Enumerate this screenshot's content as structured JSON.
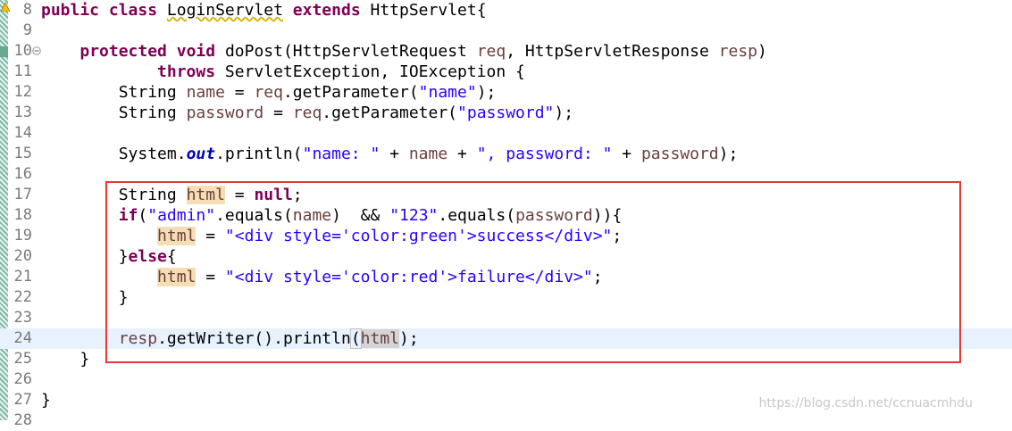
{
  "editor": {
    "lines": [
      {
        "n": "8"
      },
      {
        "n": "9"
      },
      {
        "n": "10"
      },
      {
        "n": "11"
      },
      {
        "n": "12"
      },
      {
        "n": "13"
      },
      {
        "n": "14"
      },
      {
        "n": "15"
      },
      {
        "n": "16"
      },
      {
        "n": "17"
      },
      {
        "n": "18"
      },
      {
        "n": "19"
      },
      {
        "n": "20"
      },
      {
        "n": "21"
      },
      {
        "n": "22"
      },
      {
        "n": "23"
      },
      {
        "n": "24"
      },
      {
        "n": "25"
      },
      {
        "n": "26"
      },
      {
        "n": "27"
      },
      {
        "n": "28"
      }
    ],
    "code": {
      "l8": {
        "kw1": "public",
        "kw2": "class",
        "cls": "LoginServlet",
        "kw3": "extends",
        "rest": "HttpServlet{"
      },
      "l10": {
        "kw1": "protected",
        "kw2": "void",
        "rest1": "doPost(HttpServletRequest ",
        "p1": "req",
        "rest2": ", HttpServletResponse ",
        "p2": "resp",
        "rest3": ")"
      },
      "l11": {
        "kw": "throws",
        "rest": "ServletException, IOException {"
      },
      "l12": {
        "t1": "String ",
        "v1": "name",
        "t2": " = ",
        "v2": "req",
        "t3": ".getParameter(",
        "s": "\"name\"",
        "t4": ");"
      },
      "l13": {
        "t1": "String ",
        "v1": "password",
        "t2": " = ",
        "v2": "req",
        "t3": ".getParameter(",
        "s": "\"password\"",
        "t4": ");"
      },
      "l15": {
        "t1": "System.",
        "f": "out",
        "t2": ".println(",
        "s1": "\"name: \"",
        "t3": " + ",
        "v1": "name",
        "t4": " + ",
        "s2": "\", password: \"",
        "t5": " + ",
        "v2": "password",
        "t6": ");"
      },
      "l17": {
        "t1": "String ",
        "v1": "html",
        "t2": " = ",
        "kw": "null",
        "t3": ";"
      },
      "l18": {
        "kw": "if",
        "t1": "(",
        "s1": "\"admin\"",
        "t2": ".equals(",
        "v1": "name",
        "t3": ")  && ",
        "s2": "\"123\"",
        "t4": ".equals(",
        "v2": "password",
        "t5": ")){"
      },
      "l19": {
        "v": "html",
        "t1": " = ",
        "s": "\"<div style='color:green'>success</div>\"",
        "t2": ";"
      },
      "l20": {
        "t1": "}",
        "kw": "else",
        "t2": "{"
      },
      "l21": {
        "v": "html",
        "t1": " = ",
        "s": "\"<div style='color:red'>failure</div>\"",
        "t2": ";"
      },
      "l22": {
        "t1": "}"
      },
      "l24": {
        "v1": "resp",
        "t1": ".getWriter().println",
        "b1": "(",
        "v2": "html",
        "t2": ");"
      },
      "l25": {
        "t1": "}"
      },
      "l27": {
        "t1": "}"
      }
    },
    "fold_icon": "minus-circle-icon",
    "warning_icon": "warning-icon"
  },
  "watermark": "https://blog.csdn.net/ccnuacmhdu"
}
